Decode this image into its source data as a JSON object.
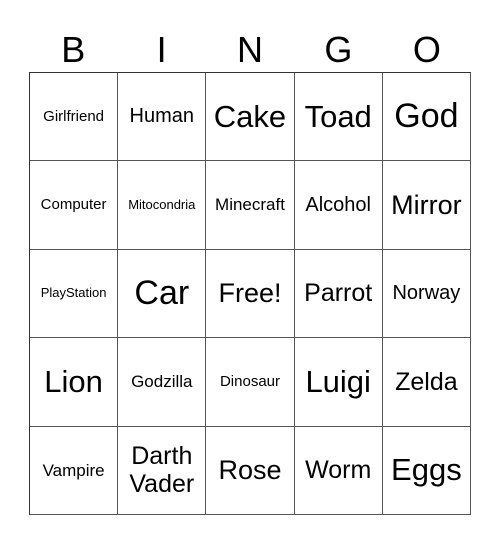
{
  "header": [
    "B",
    "I",
    "N",
    "G",
    "O"
  ],
  "rows": [
    [
      "Girlfriend",
      "Human",
      "Cake",
      "Toad",
      "God"
    ],
    [
      "Computer",
      "Mitocondria",
      "Minecraft",
      "Alcohol",
      "Mirror"
    ],
    [
      "PlayStation",
      "Car",
      "Free!",
      "Parrot",
      "Norway"
    ],
    [
      "Lion",
      "Godzilla",
      "Dinosaur",
      "Luigi",
      "Zelda"
    ],
    [
      "Vampire",
      "Darth Vader",
      "Rose",
      "Worm",
      "Eggs"
    ]
  ]
}
